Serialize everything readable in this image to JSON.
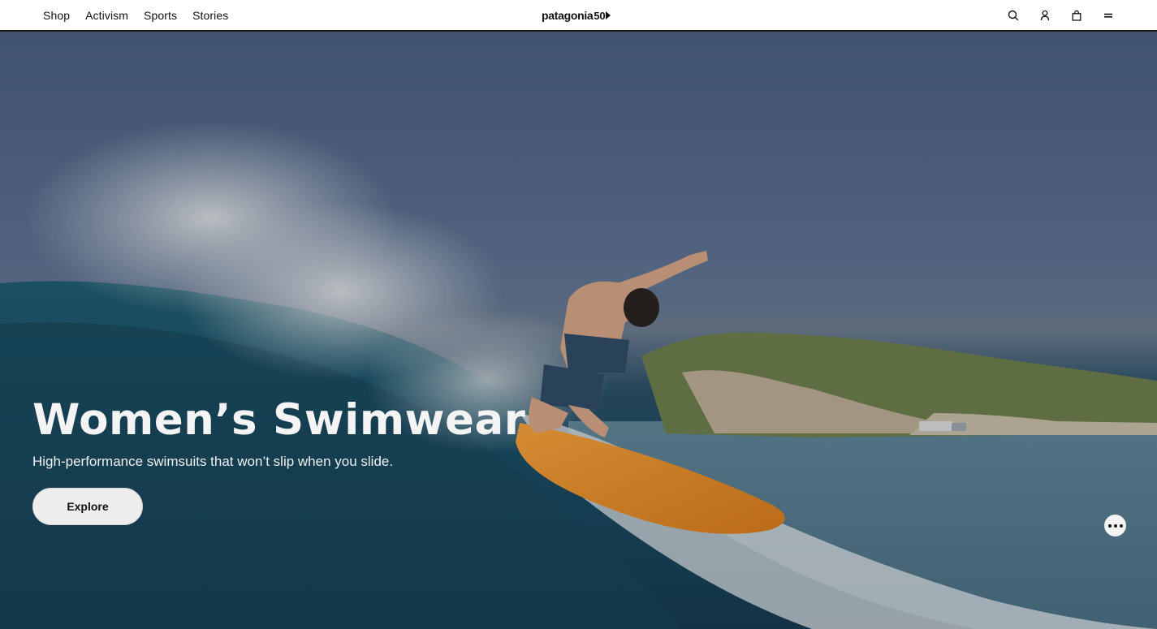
{
  "nav": {
    "items": [
      {
        "label": "Shop"
      },
      {
        "label": "Activism"
      },
      {
        "label": "Sports"
      },
      {
        "label": "Stories"
      }
    ]
  },
  "logo": {
    "text": "patagonia",
    "anniversary": "50"
  },
  "header_icons": [
    "search-icon",
    "account-icon",
    "cart-icon",
    "menu-icon"
  ],
  "hero": {
    "title": "Women’s Swimwear",
    "subtitle": "High-performance swimsuits that won’t slip when you slide.",
    "cta_label": "Explore"
  },
  "colors": {
    "header_bg": "#ffffff",
    "text_dark": "#111111",
    "button_bg": "#eeeeee"
  }
}
